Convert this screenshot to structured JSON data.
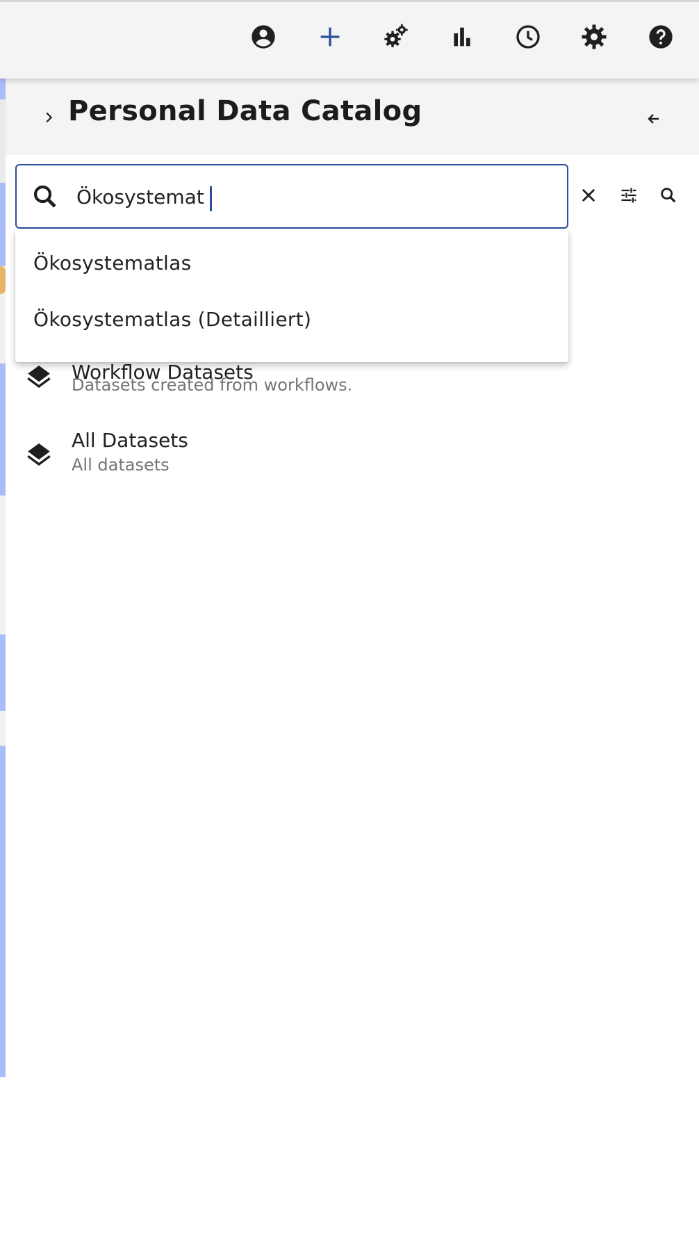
{
  "toolbar": {
    "icons": [
      "account-circle-icon",
      "add-icon",
      "workflow-gears-icon",
      "bar-chart-icon",
      "history-clock-icon",
      "settings-gear-icon",
      "help-icon"
    ],
    "accent_color": "#2d4c9b"
  },
  "panel": {
    "title": "Personal Data Catalog"
  },
  "search": {
    "value": "Ökosystemat",
    "suggestions": [
      "Ökosystematlas",
      "Ökosystematlas (Detailliert)"
    ]
  },
  "catalog": {
    "items": [
      {
        "title": "Workflow Datasets",
        "subtitle": "Datasets created from workflows."
      },
      {
        "title": "All Datasets",
        "subtitle": "All datasets"
      }
    ]
  }
}
